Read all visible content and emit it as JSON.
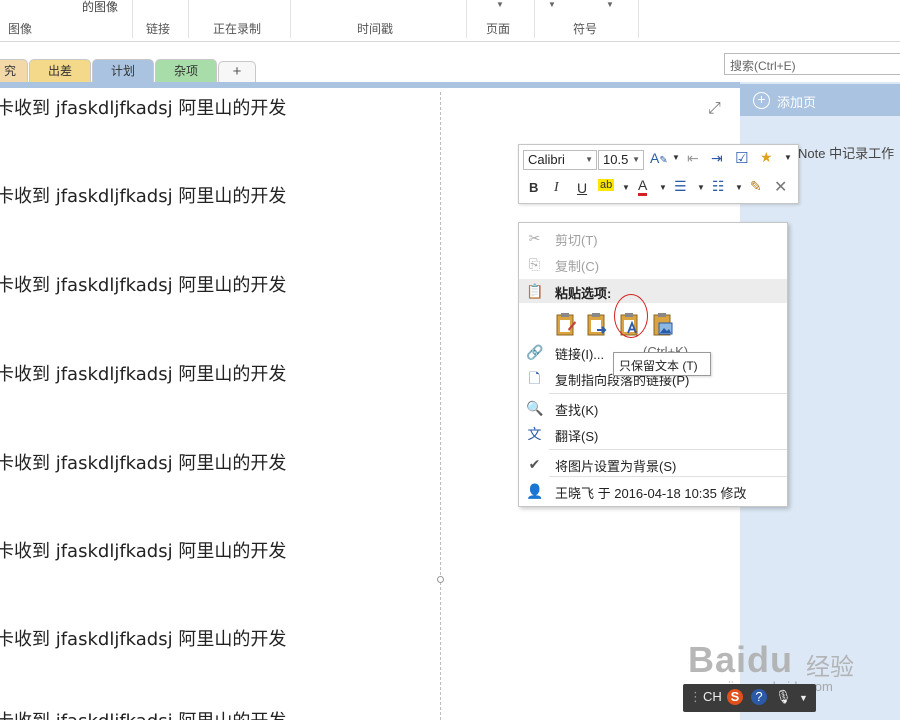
{
  "colors": {
    "tab_research": "#f4d9a8",
    "tab_travel": "#f4d98a",
    "tab_plan": "#a9c3e0",
    "tab_misc": "#a8dca8",
    "pane": "#dce8f5",
    "accent": "#a9c3e0",
    "highlight": "#d42020"
  },
  "ribbon": {
    "partial_label": "的图像",
    "groups": [
      "图像",
      "链接",
      "正在录制",
      "时间戳",
      "页面",
      "符号"
    ]
  },
  "tabs": [
    {
      "label": "究"
    },
    {
      "label": "出差"
    },
    {
      "label": "计划"
    },
    {
      "label": "杂项"
    },
    {
      "label": "+"
    }
  ],
  "search": {
    "placeholder": "搜索(Ctrl+E)"
  },
  "sidebar": {
    "add_page": "添加页",
    "page_item": "Note 中记录工作"
  },
  "note": {
    "lines": [
      "卡收到 jfaskdljfkadsj 阿里山的开发",
      "卡收到 jfaskdljfkadsj 阿里山的开发",
      "卡收到 jfaskdljfkadsj 阿里山的开发",
      "卡收到 jfaskdljfkadsj 阿里山的开发",
      "卡收到 jfaskdljfkadsj 阿里山的开发",
      "卡收到 jfaskdljfkadsj 阿里山的开发",
      "卡收到 jfaskdljfkadsj 阿里山的开发",
      "卡收到 jfaskdljfkadsj 阿里山的开发"
    ]
  },
  "mini_toolbar": {
    "font": "Calibri",
    "size": "10.5"
  },
  "context_menu": {
    "cut": "剪切(T)",
    "copy": "复制(C)",
    "paste_header": "粘贴选项:",
    "link": "链接(I)...",
    "link_shortcut": "(Ctrl+K)",
    "copy_link": "复制指向段落的链接(P)",
    "find": "查找(K)",
    "translate": "翻译(S)",
    "set_background": "将图片设置为背景(S)",
    "author": "王晓飞 于 2016-04-18 10:35 修改"
  },
  "tooltip": "只保留文本 (T)",
  "watermark": {
    "brand": "Baidu",
    "suffix": "经验",
    "url": "jingyan.baidu.com"
  },
  "ime": {
    "mode": "CH"
  }
}
